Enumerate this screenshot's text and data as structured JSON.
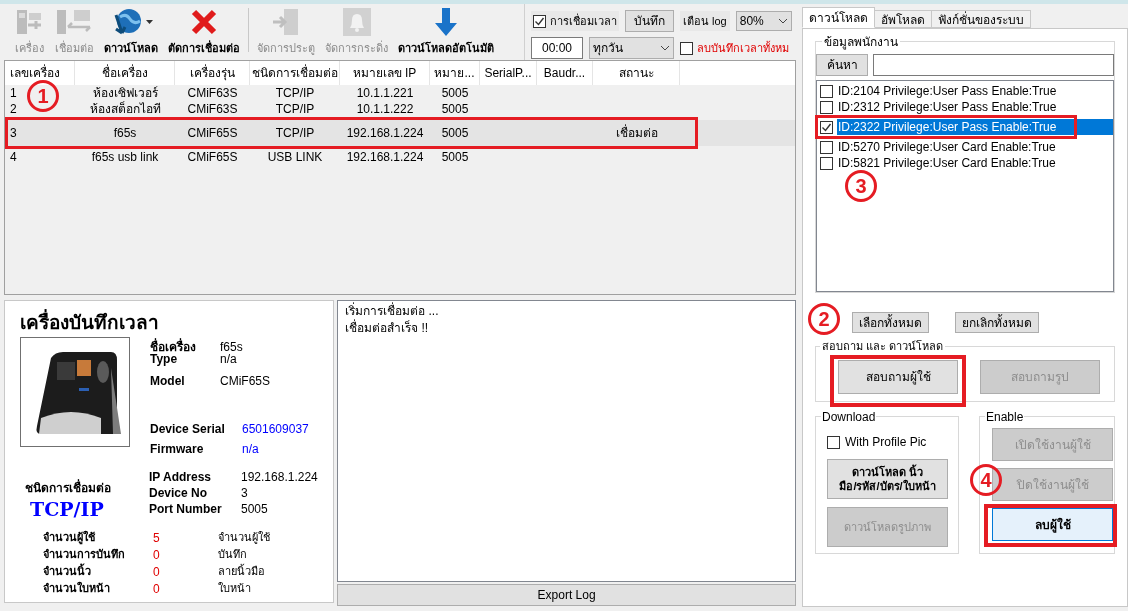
{
  "toolbar": {
    "buttons": [
      {
        "kind": "machine",
        "label": "เครื่อง",
        "disabled": true,
        "has_menu": false
      },
      {
        "kind": "connect",
        "label": "เชื่อมต่อ",
        "disabled": true,
        "has_menu": false
      },
      {
        "kind": "globe",
        "label": "ดาวน์โหลด",
        "disabled": false,
        "has_menu": true
      },
      {
        "kind": "cross",
        "label": "ตัดการเชื่อมต่อ",
        "disabled": false,
        "has_menu": false
      },
      {
        "kind": "door",
        "label": "จัดการประตู",
        "disabled": true,
        "has_menu": false
      },
      {
        "kind": "bell",
        "label": "จัดการกระดิ่ง",
        "disabled": true,
        "has_menu": false
      },
      {
        "kind": "arrow",
        "label": "ดาวน์โหลดอัตโนมัติ",
        "disabled": false,
        "has_menu": false
      }
    ]
  },
  "time_sync": {
    "checkbox": {
      "label": "การเชื่อมเวลา",
      "checked": true
    },
    "save_button": "บันทึก",
    "log_warning_label": "เตือน log",
    "log_warning_select": "80%",
    "time": "00:00",
    "schedule": "ทุกวัน",
    "delete_all": {
      "label": "ลบบันทึกเวลาทั้งหม",
      "checked": false
    }
  },
  "device_table": {
    "columns": [
      "เลขเครื่อง",
      "ชื่อเครื่อง",
      "เครื่องรุ่น",
      "ชนิดการเชื่อมต่อ",
      "หมายเลข IP",
      "หมาย...",
      "SerialP...",
      "Baudr...",
      "สถานะ"
    ],
    "rows": [
      {
        "cells": [
          "1",
          "ห้องเซิฟเวอร์",
          "CMiF63S",
          "TCP/IP",
          "10.1.1.221",
          "5005",
          "",
          "",
          ""
        ],
        "selected": false,
        "marked": false
      },
      {
        "cells": [
          "2",
          "ห้องสต็อกไอที",
          "CMiF63S",
          "TCP/IP",
          "10.1.1.222",
          "5005",
          "",
          "",
          ""
        ],
        "selected": false,
        "marked": false
      },
      {
        "cells": [
          "3",
          "f65s",
          "CMiF65S",
          "TCP/IP",
          "192.168.1.224",
          "5005",
          "",
          "",
          "เชื่อมต่อ"
        ],
        "selected": true,
        "marked": true
      },
      {
        "cells": [
          "4",
          "f65s usb link",
          "CMiF65S",
          "USB LINK",
          "192.168.1.224",
          "5005",
          "",
          "",
          ""
        ],
        "selected": false,
        "marked": false
      }
    ]
  },
  "device_info": {
    "title": "เครื่องบันทึกเวลา",
    "field_groups": [
      [
        {
          "label": "ชื่อเครื่อง",
          "value": "f65s",
          "color": "#000000"
        },
        {
          "label": "Type",
          "value": "n/a",
          "color": "#000000"
        },
        {
          "label": "Model",
          "value": "CMiF65S",
          "color": "#000000"
        }
      ],
      [
        {
          "label": "Device Serial",
          "value": "6501609037",
          "color": "#0000ff"
        },
        {
          "label": "Firmware",
          "value": "n/a",
          "color": "#0000ff"
        }
      ],
      [
        {
          "label": "IP Address",
          "value": "192.168.1.224",
          "color": "#000000"
        },
        {
          "label": "Device No",
          "value": "3",
          "color": "#000000"
        },
        {
          "label": "Port Number",
          "value": "5005",
          "color": "#000000"
        }
      ]
    ],
    "connection": {
      "label": "ชนิดการเชื่อมต่อ",
      "value": "TCP/IP"
    },
    "counts": [
      {
        "label": "จำนวนผู้ใช้",
        "value": "5",
        "unit": "จำนวนผู้ใช้"
      },
      {
        "label": "จำนวนการบันทึก",
        "value": "0",
        "unit": "บันทึก"
      },
      {
        "label": "จำนวนนิ้ว",
        "value": "0",
        "unit": "ลายนิ้วมือ"
      },
      {
        "label": "จำนวนใบหน้า",
        "value": "0",
        "unit": "ใบหน้า"
      }
    ]
  },
  "log": {
    "lines": [
      "เริ่มการเชื่อมต่อ ...",
      "เชื่อมต่อสำเร็จ !!"
    ],
    "export_button": "Export Log"
  },
  "right_panel": {
    "tabs": [
      {
        "label": "ดาวน์โหลด",
        "selected": true
      },
      {
        "label": "อัพโหลด",
        "selected": false
      },
      {
        "label": "ฟังก์ชั่นของระบบ",
        "selected": false
      }
    ],
    "employee_group": {
      "title": "ข้อมูลพนักงาน",
      "search_button": "ค้นหา",
      "users": [
        {
          "label": "ID:2104 Privilege:User Pass Enable:True",
          "checked": false,
          "selected": false,
          "marked": false
        },
        {
          "label": "ID:2312 Privilege:User Pass Enable:True",
          "checked": false,
          "selected": false,
          "marked": false
        },
        {
          "label": "ID:2322 Privilege:User Pass Enable:True",
          "checked": true,
          "selected": true,
          "marked": true
        },
        {
          "label": "ID:5270 Privilege:User Card Enable:True",
          "checked": false,
          "selected": false,
          "marked": false
        },
        {
          "label": "ID:5821 Privilege:User Card Enable:True",
          "checked": false,
          "selected": false,
          "marked": false
        }
      ]
    },
    "select_all": "เลือกทั้งหมด",
    "deselect_all": "ยกเลิกทั้งหมด",
    "query_group": {
      "title": "สอบถาม และ ดาวน์โหลด",
      "buttons": [
        {
          "label": "สอบถามผู้ใช้",
          "disabled": false,
          "marked": true
        },
        {
          "label": "สอบถามรูป",
          "disabled": true,
          "marked": false
        }
      ]
    },
    "download_group": {
      "title": "Download",
      "checkbox": {
        "label": "With Profile Pic",
        "checked": false
      },
      "buttons": [
        {
          "label": "ดาวน์โหลด นิ้ว\nมือ/รหัส/บัตร/ใบหน้า",
          "disabled": false
        },
        {
          "label": "ดาวน์โหลดรูปภาพ",
          "disabled": true
        }
      ]
    },
    "enable_group": {
      "title": "Enable",
      "buttons": [
        {
          "label": "เปิดใช้งานผู้ใช้",
          "disabled": true,
          "focused": false,
          "marked": false
        },
        {
          "label": "ปิดใช้งานผู้ใช้",
          "disabled": true,
          "focused": false,
          "marked": false
        },
        {
          "label": "ลบผู้ใช้",
          "disabled": false,
          "focused": true,
          "marked": true
        }
      ]
    }
  },
  "annotations": [
    {
      "number": "1"
    },
    {
      "number": "2"
    },
    {
      "number": "3"
    },
    {
      "number": "4"
    }
  ]
}
